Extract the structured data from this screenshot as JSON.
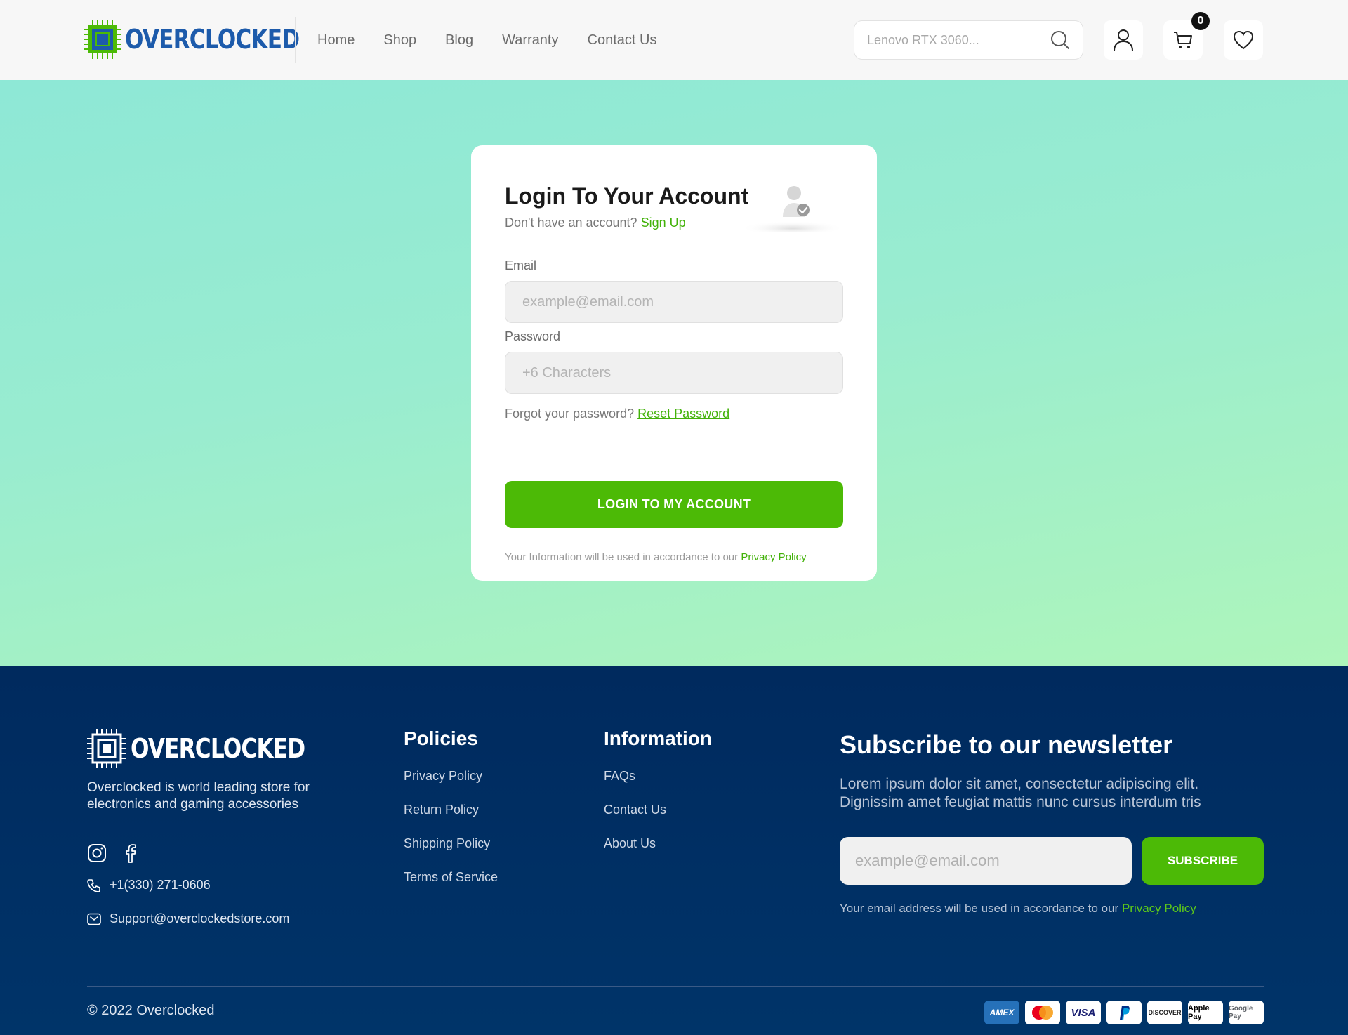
{
  "brand": {
    "name": "OVERCLOCKED",
    "accent": "#4cba06",
    "brand_blue": "#1d5bab"
  },
  "nav": {
    "items": [
      "Home",
      "Shop",
      "Blog",
      "Warranty",
      "Contact Us"
    ]
  },
  "search": {
    "placeholder": "Lenovo RTX 3060..."
  },
  "header_icons": {
    "account": "user-icon",
    "cart": "cart-icon",
    "wishlist": "heart-icon",
    "cart_count": "0"
  },
  "login": {
    "title": "Login To Your Account",
    "signup_prompt": "Don't have an account?",
    "signup_link": "Sign Up",
    "email_label": "Email",
    "email_placeholder": "example@email.com",
    "password_label": "Password",
    "password_placeholder": "+6 Characters",
    "forgot_prompt": "Forgot your password?",
    "reset_link": "Reset Password",
    "submit_label": "LOGIN TO MY ACCOUNT",
    "note": "Your Information will be used in accordance to our",
    "note_link": "Privacy Policy"
  },
  "footer": {
    "logo": "OVERCLOCKED",
    "description": "Overclocked is world leading store for electronics and gaming accessories",
    "phone": "+1(330) 271-0606",
    "email": "Support@overclockedstore.com",
    "policies": {
      "title": "Policies",
      "links": [
        "Privacy Policy",
        "Return Policy",
        "Shipping Policy",
        "Terms of Service"
      ]
    },
    "information": {
      "title": "Information",
      "links": [
        "FAQs",
        "Contact Us",
        "About Us"
      ]
    },
    "newsletter": {
      "title": "Subscribe to our newsletter",
      "description": "Lorem ipsum dolor sit amet, consectetur adipiscing elit. Dignissim amet feugiat mattis nunc cursus interdum tris",
      "placeholder": "example@email.com",
      "button": "SUBSCRIBE",
      "note": "Your email address will be used in accordance to our",
      "note_link": "Privacy Policy"
    },
    "copyright": "© 2022 Overclocked",
    "payments": [
      "AMEX",
      "Mastercard",
      "VISA",
      "PayPal",
      "DISCOVER",
      "Apple Pay",
      "Google Pay"
    ]
  }
}
